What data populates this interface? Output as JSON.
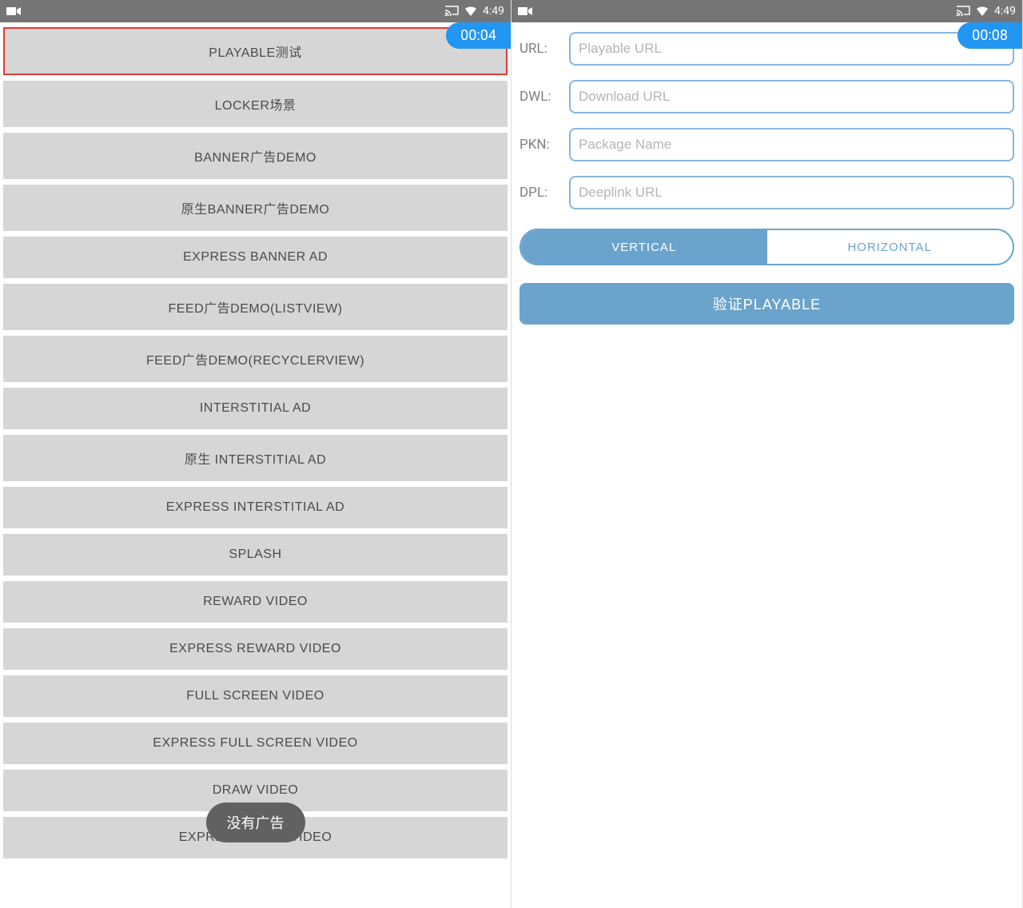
{
  "status_bar": {
    "clock": "4:49"
  },
  "left": {
    "timer": "00:04",
    "menu": [
      "PLAYABLE测试",
      "LOCKER场景",
      "BANNER广告DEMO",
      "原生BANNER广告DEMO",
      "EXPRESS BANNER AD",
      "FEED广告DEMO(LISTVIEW)",
      "FEED广告DEMO(RECYCLERVIEW)",
      "INTERSTITIAL AD",
      "原生 INTERSTITIAL AD",
      "EXPRESS INTERSTITIAL AD",
      "SPLASH",
      "REWARD VIDEO",
      "EXPRESS REWARD VIDEO",
      "FULL SCREEN VIDEO",
      "EXPRESS FULL SCREEN VIDEO",
      "DRAW           VIDEO",
      "EXPRESS DRAW  VIDEO"
    ],
    "toast": "没有广告"
  },
  "right": {
    "timer": "00:08",
    "fields": {
      "url_label": "URL:",
      "url_placeholder": "Playable URL",
      "dwl_label": "DWL:",
      "dwl_placeholder": "Download URL",
      "pkn_label": "PKN:",
      "pkn_placeholder": "Package Name",
      "dpl_label": "DPL:",
      "dpl_placeholder": "Deeplink URL"
    },
    "orientation": {
      "vertical": "VERTICAL",
      "horizontal": "HORIZONTAL"
    },
    "verify": "验证PLAYABLE"
  }
}
